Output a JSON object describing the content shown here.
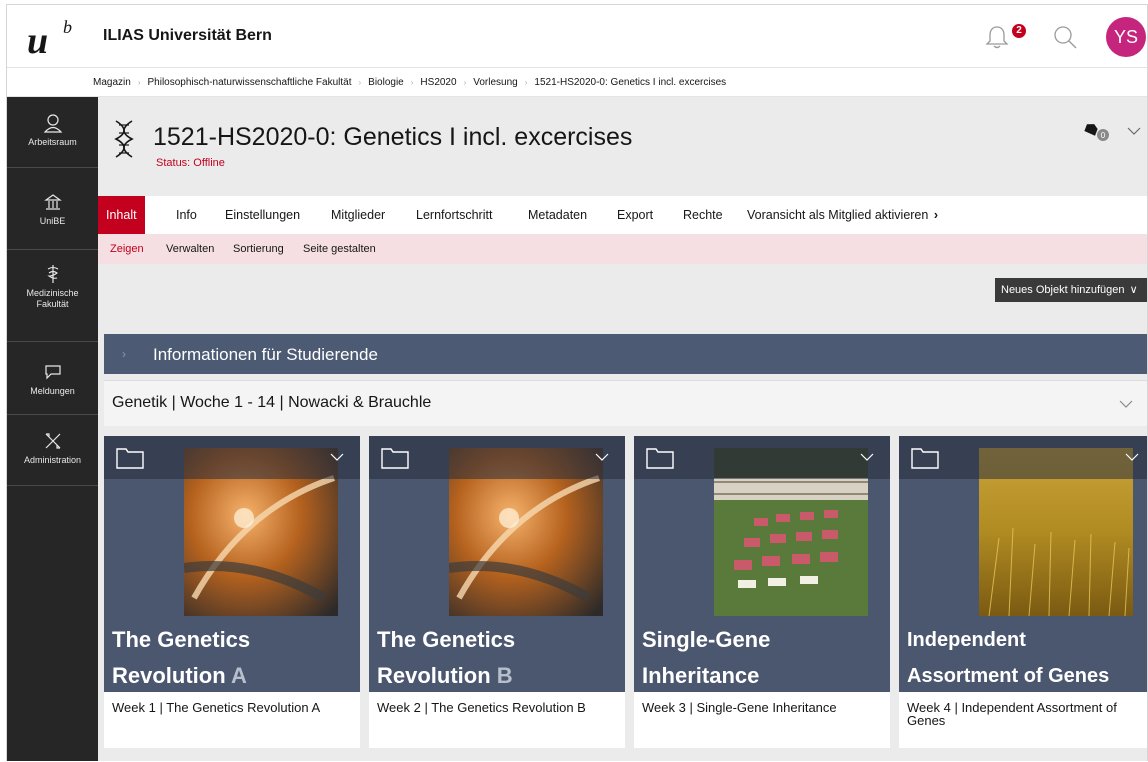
{
  "header": {
    "app_title": "ILIAS Universität Bern",
    "notification_count": "2",
    "avatar_initials": "YS",
    "avatar_color": "#c5257c"
  },
  "breadcrumb": [
    "Magazin",
    "Philosophisch-naturwissenschaftliche Fakultät",
    "Biologie",
    "HS2020",
    "Vorlesung",
    "1521-HS2020-0: Genetics I incl. excercises"
  ],
  "sidebar": {
    "items": [
      {
        "label": "Arbeitsraum",
        "icon": "user-icon"
      },
      {
        "label": "UniBE",
        "icon": "building-icon"
      },
      {
        "label": "Medizinische Fakultät",
        "icon": "caduceus-icon"
      },
      {
        "label": "Meldungen",
        "icon": "chat-icon"
      },
      {
        "label": "Administration",
        "icon": "tools-icon"
      }
    ]
  },
  "object": {
    "title": "1521-HS2020-0: Genetics I incl. excercises",
    "status": "Status: Offline",
    "icon": "dna-icon"
  },
  "tabs": [
    "Inhalt",
    "Info",
    "Einstellungen",
    "Mitglieder",
    "Lernfortschritt",
    "Metadaten",
    "Export",
    "Rechte",
    "Voransicht als Mitglied aktivieren"
  ],
  "subtabs": [
    "Zeigen",
    "Verwalten",
    "Sortierung",
    "Seite gestalten"
  ],
  "add_object_label": "Neues Objekt hinzufügen",
  "block": {
    "title": "Informationen für Studierende"
  },
  "sub_block": {
    "title": "Genetik | Woche 1 - 14 | Nowacki & Brauchle"
  },
  "cards": [
    {
      "title_line1": "The Genetics",
      "title_line2": "Revolution",
      "title_accent": "A",
      "caption": "Week 1 | The Genetics Revolution A",
      "image": "dna-helix-image"
    },
    {
      "title_line1": "The Genetics",
      "title_line2": "Revolution",
      "title_accent": "B",
      "caption": "Week 2 | The Genetics Revolution B",
      "image": "dna-helix-image"
    },
    {
      "title_line1": "Single-Gene",
      "title_line2": "Inheritance",
      "title_accent": "",
      "caption": "Week 3 | Single-Gene Inheritance",
      "image": "garden-image"
    },
    {
      "title_line1": "Independent",
      "title_line2": "Assortment of Genes",
      "title_accent": "",
      "caption": "Week 4 | Independent Assortment of Genes",
      "image": "wheat-field-image"
    }
  ],
  "colors": {
    "accent": "#c3001d",
    "sidebar": "#262626",
    "block_header": "#4c5a74",
    "card_background": "#4b566f",
    "subtab_background": "#f5dfe2"
  }
}
